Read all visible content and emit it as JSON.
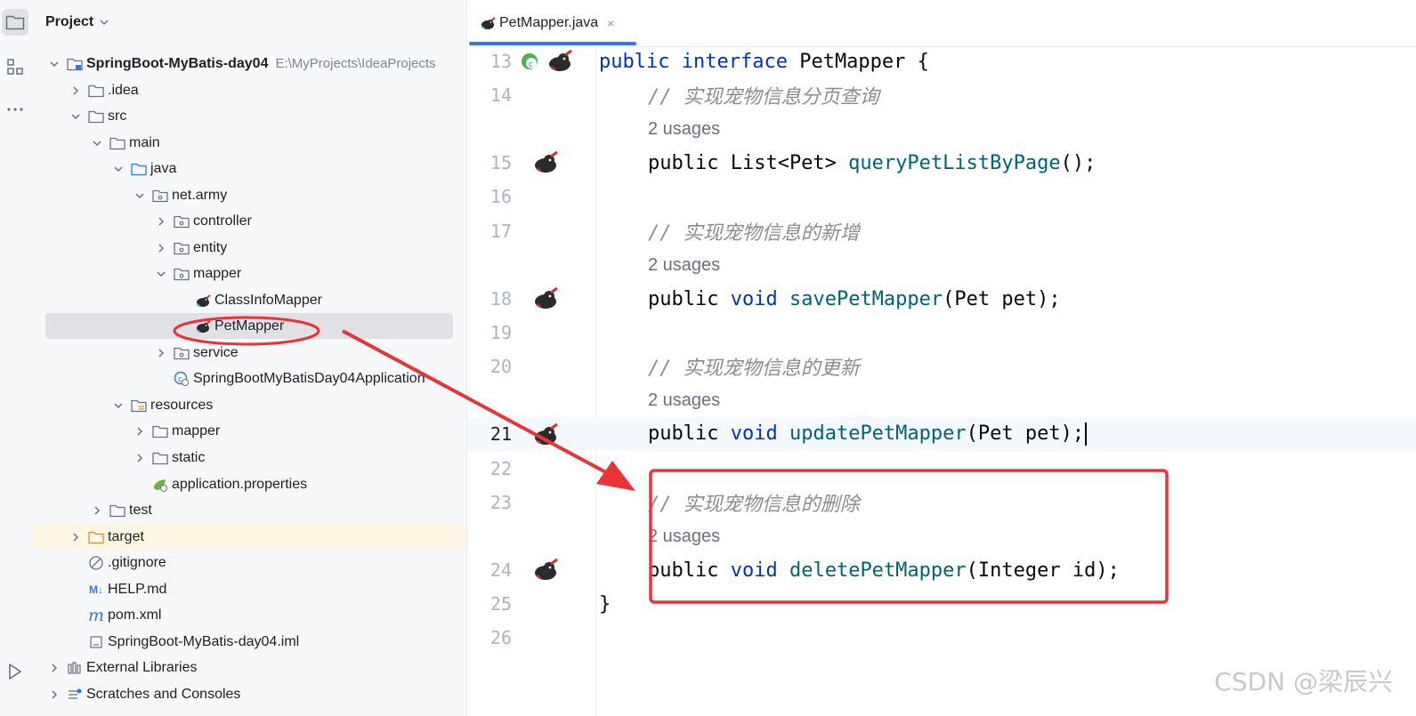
{
  "activity_bar": {
    "icons": [
      "folder-icon",
      "structure-icon",
      "more-icon",
      "run-icon"
    ]
  },
  "project_panel": {
    "title": "Project",
    "root": {
      "label": "SpringBoot-MyBatis-day04",
      "path": "E:\\MyProjects\\IdeaProjects"
    },
    "items": [
      {
        "label": ".idea"
      },
      {
        "label": "src"
      },
      {
        "label": "main"
      },
      {
        "label": "java"
      },
      {
        "label": "net.army"
      },
      {
        "label": "controller"
      },
      {
        "label": "entity"
      },
      {
        "label": "mapper"
      },
      {
        "label": "ClassInfoMapper"
      },
      {
        "label": "PetMapper"
      },
      {
        "label": "service"
      },
      {
        "label": "SpringBootMyBatisDay04Application"
      },
      {
        "label": "resources"
      },
      {
        "label": "mapper"
      },
      {
        "label": "static"
      },
      {
        "label": "application.properties"
      },
      {
        "label": "test"
      },
      {
        "label": "target"
      },
      {
        "label": ".gitignore"
      },
      {
        "label": "HELP.md"
      },
      {
        "label": "pom.xml"
      },
      {
        "label": "SpringBoot-MyBatis-day04.iml"
      },
      {
        "label": "External Libraries"
      },
      {
        "label": "Scratches and Consoles"
      }
    ],
    "md_badge": "M↓",
    "maven_badge": "m"
  },
  "editor": {
    "tab": {
      "label": "PetMapper.java",
      "close": "×"
    },
    "lines": {
      "l13": {
        "num": "13",
        "p1": "public",
        "p2": "interface",
        "p3": "PetMapper {"
      },
      "l14": {
        "num": "14",
        "comment": "// 实现宠物信息分页查询"
      },
      "u14": "2 usages",
      "l15": {
        "num": "15",
        "p1": "public List<Pet> ",
        "fn": "queryPetListByPage",
        "rest": "();"
      },
      "l16": {
        "num": "16"
      },
      "l17": {
        "num": "17",
        "comment": "// 实现宠物信息的新增"
      },
      "u17": "2 usages",
      "l18": {
        "num": "18",
        "p1": "public",
        "kw": "void",
        "fn": "savePetMapper",
        "rest": "(Pet pet);"
      },
      "l19": {
        "num": "19"
      },
      "l20": {
        "num": "20",
        "comment": "// 实现宠物信息的更新"
      },
      "u20": "2 usages",
      "l21": {
        "num": "21",
        "p1": "public",
        "kw": "void",
        "fn": "updatePetMapper",
        "rest": "(Pet pet);"
      },
      "l22": {
        "num": "22"
      },
      "l23": {
        "num": "23",
        "comment": "// 实现宠物信息的删除"
      },
      "u23": "2 usages",
      "l24": {
        "num": "24",
        "p1": "public",
        "kw": "void",
        "fn": "deletePetMapper",
        "rest": "(Integer id);"
      },
      "l25": {
        "num": "25",
        "code": "}"
      },
      "l26": {
        "num": "26"
      }
    }
  },
  "watermark": "CSDN @梁辰兴",
  "colors": {
    "annotation_red": "#e8333a",
    "keyword": "#0033b3",
    "method": "#00627a",
    "comment": "#8c8c8c",
    "selection": "#dfe1e5",
    "tab_accent": "#3574f0"
  }
}
